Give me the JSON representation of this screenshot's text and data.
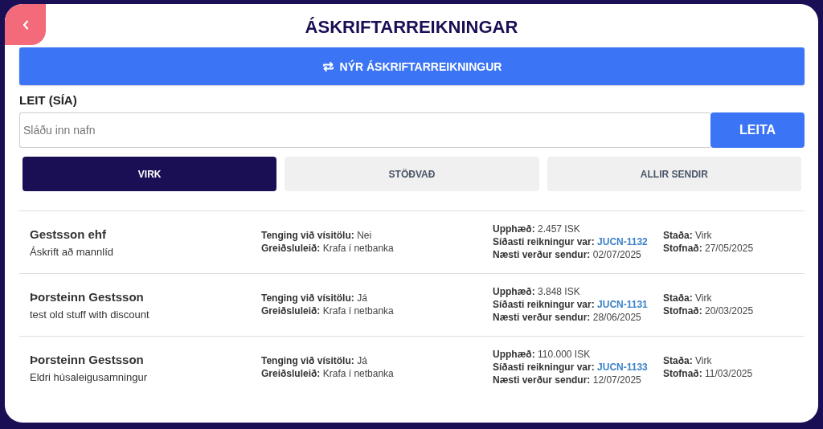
{
  "header": {
    "title": "ÁSKRIFTARREIKNINGAR"
  },
  "new_button": {
    "label": "NÝR ÁSKRIFTARREIKNINGUR"
  },
  "search": {
    "label": "LEIT (SÍA)",
    "placeholder": "Sláðu inn nafn",
    "button": "LEITA"
  },
  "tabs": [
    {
      "label": "VIRK",
      "selected": true
    },
    {
      "label": "STÖÐVAÐ",
      "selected": false
    },
    {
      "label": "ALLIR SENDIR",
      "selected": false
    }
  ],
  "subscriptions": [
    {
      "name": "Gestsson ehf",
      "description": "Áskrift að mannlíd",
      "details": [
        [
          {
            "label": "Tenging við vísitölu:",
            "value": "Nei",
            "kind": "text"
          },
          {
            "label": "Greiðsluleið:",
            "value": "Krafa í netbanka",
            "kind": "text"
          }
        ],
        [
          {
            "label": "Upphæð:",
            "value": "2.457 ISK",
            "kind": "text"
          },
          {
            "label": "Síðasti reikningur var:",
            "value": "JUCN-1132",
            "kind": "link"
          },
          {
            "label": "Næsti verður sendur:",
            "value": "02/07/2025",
            "kind": "text"
          }
        ],
        [
          {
            "label": "Staða:",
            "value": "Virk",
            "kind": "text"
          },
          {
            "label": "Stofnað:",
            "value": "27/05/2025",
            "kind": "text"
          }
        ]
      ]
    },
    {
      "name": "Þorsteinn Gestsson",
      "description": "test old stuff with discount",
      "details": [
        [
          {
            "label": "Tenging við vísitölu:",
            "value": "Já",
            "kind": "text"
          },
          {
            "label": "Greiðsluleið:",
            "value": "Krafa í netbanka",
            "kind": "text"
          }
        ],
        [
          {
            "label": "Upphæð:",
            "value": "3.848 ISK",
            "kind": "text"
          },
          {
            "label": "Síðasti reikningur var:",
            "value": "JUCN-1131",
            "kind": "link"
          },
          {
            "label": "Næsti verður sendur:",
            "value": "28/06/2025",
            "kind": "text"
          }
        ],
        [
          {
            "label": "Staða:",
            "value": "Virk",
            "kind": "text"
          },
          {
            "label": "Stofnað:",
            "value": "20/03/2025",
            "kind": "text"
          }
        ]
      ]
    },
    {
      "name": "Þorsteinn Gestsson",
      "description": "Eldri húsaleigusamningur",
      "details": [
        [
          {
            "label": "Tenging við vísitölu:",
            "value": "Já",
            "kind": "text"
          },
          {
            "label": "Greiðsluleið:",
            "value": "Krafa í netbanka",
            "kind": "text"
          }
        ],
        [
          {
            "label": "Upphæð:",
            "value": "110.000 ISK",
            "kind": "text"
          },
          {
            "label": "Síðasti reikningur var:",
            "value": "JUCN-1133",
            "kind": "link"
          },
          {
            "label": "Næsti verður sendur:",
            "value": "12/07/2025",
            "kind": "text"
          }
        ],
        [
          {
            "label": "Staða:",
            "value": "Virk",
            "kind": "text"
          },
          {
            "label": "Stofnað:",
            "value": "11/03/2025",
            "kind": "text"
          }
        ]
      ]
    }
  ]
}
